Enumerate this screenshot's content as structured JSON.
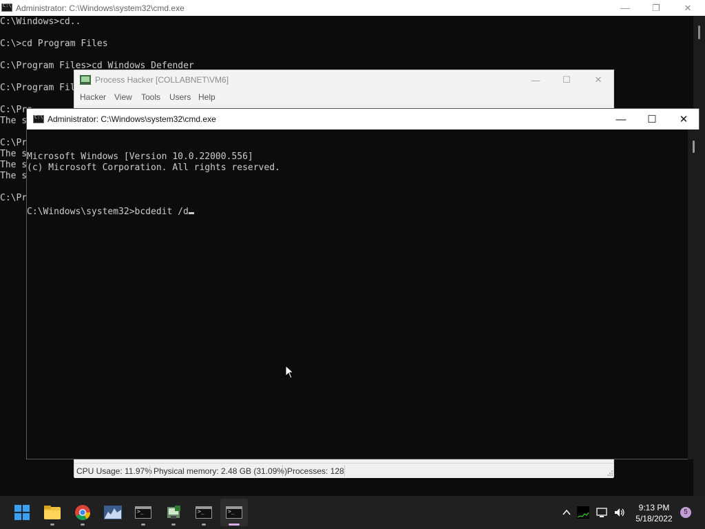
{
  "bg_cmd": {
    "title": "Administrator: C:\\Windows\\system32\\cmd.exe",
    "lines": [
      "C:\\Windows>cd..",
      "",
      "C:\\>cd Program Files",
      "",
      "C:\\Program Files>cd Windows Defender",
      "",
      "C:\\Program Fil",
      "",
      "C:\\Pro",
      "The s",
      "",
      "C:\\Pr",
      "The s",
      "The s",
      "The s",
      "",
      "C:\\Pr"
    ]
  },
  "process_hacker": {
    "title": "Process Hacker [COLLABNET\\VM6]",
    "menu": [
      "Hacker",
      "View",
      "Tools",
      "Users",
      "Help"
    ],
    "status": {
      "cpu": "CPU Usage: 11.97%",
      "memory": "Physical memory: 2.48 GB (31.09%)",
      "processes": "Processes: 128"
    }
  },
  "fg_cmd": {
    "title": "Administrator: C:\\Windows\\system32\\cmd.exe",
    "lines": [
      "Microsoft Windows [Version 10.0.22000.556]",
      "(c) Microsoft Corporation. All rights reserved.",
      ""
    ],
    "prompt": "C:\\Windows\\system32>bcdedit /d"
  },
  "taskbar": {
    "apps": [
      "start-icon",
      "file-explorer-icon",
      "chrome-icon",
      "process-hacker-icon",
      "terminal-icon",
      "server-manager-icon",
      "terminal-icon",
      "terminal-icon"
    ],
    "time": "9:13 PM",
    "date": "5/18/2022",
    "notification_count": "5"
  }
}
